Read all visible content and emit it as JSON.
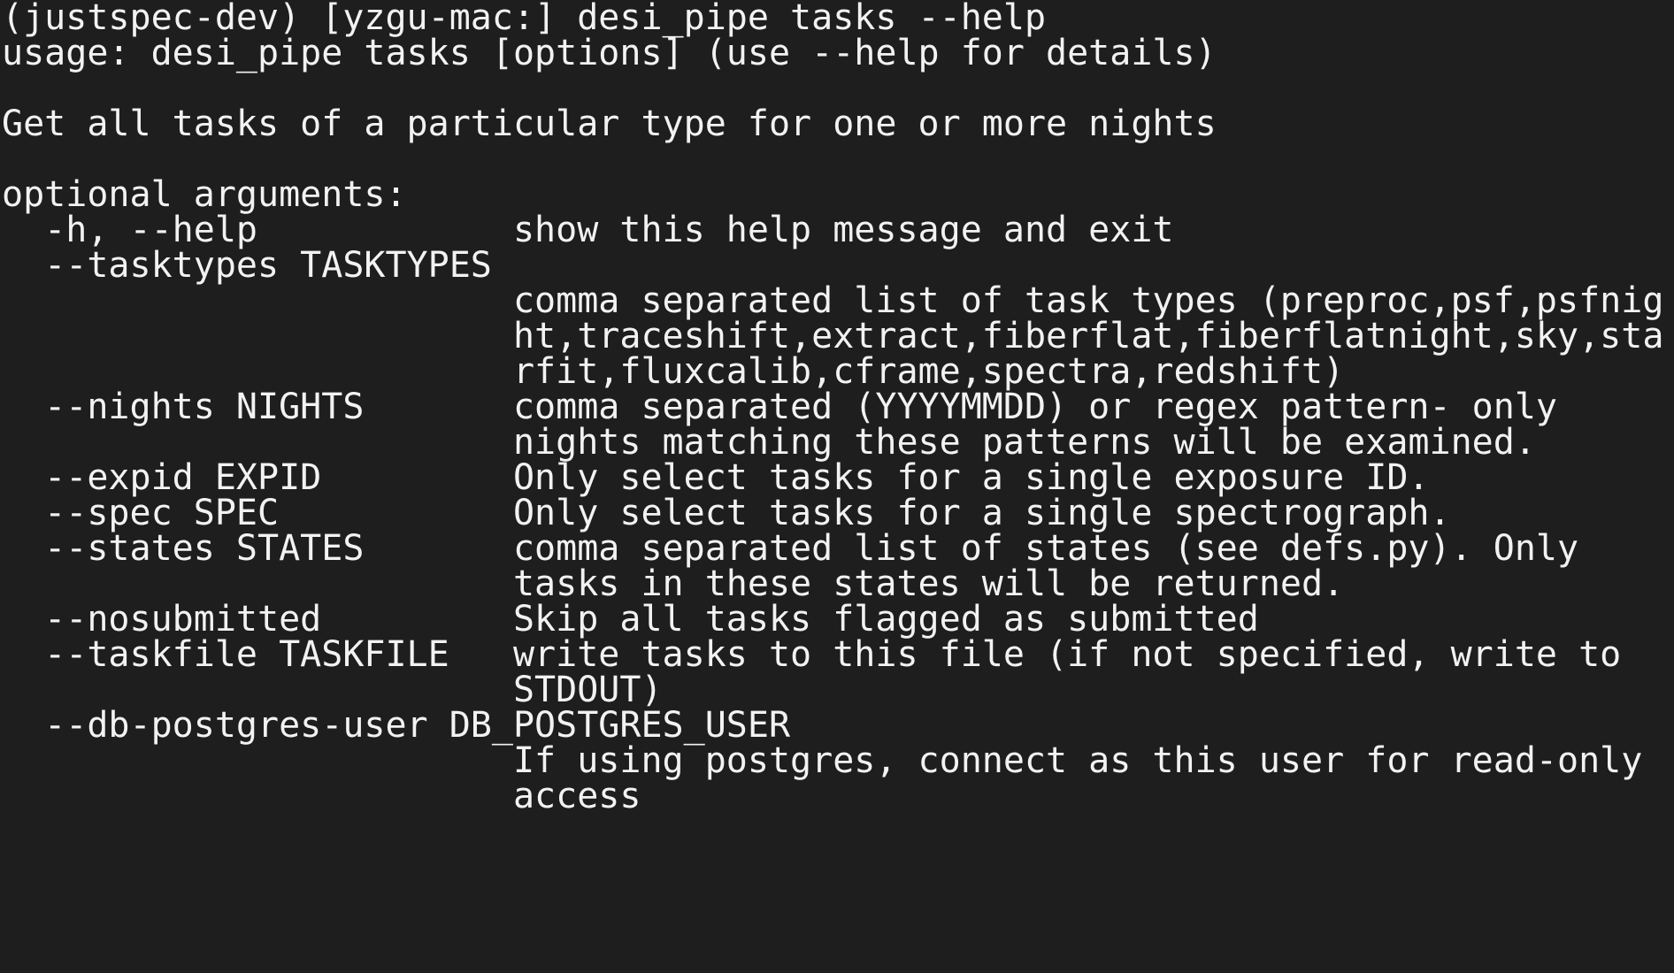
{
  "terminal": {
    "lines": [
      "(justspec-dev) [yzgu-mac:] desi_pipe tasks --help",
      "usage: desi_pipe tasks [options] (use --help for details)",
      "",
      "Get all tasks of a particular type for one or more nights",
      "",
      "optional arguments:",
      "  -h, --help            show this help message and exit",
      "  --tasktypes TASKTYPES",
      "                        comma separated list of task types (preproc,psf,psfnig",
      "                        ht,traceshift,extract,fiberflat,fiberflatnight,sky,sta",
      "                        rfit,fluxcalib,cframe,spectra,redshift)",
      "  --nights NIGHTS       comma separated (YYYYMMDD) or regex pattern- only",
      "                        nights matching these patterns will be examined.",
      "  --expid EXPID         Only select tasks for a single exposure ID.",
      "  --spec SPEC           Only select tasks for a single spectrograph.",
      "  --states STATES       comma separated list of states (see defs.py). Only",
      "                        tasks in these states will be returned.",
      "  --nosubmitted         Skip all tasks flagged as submitted",
      "  --taskfile TASKFILE   write tasks to this file (if not specified, write to",
      "                        STDOUT)",
      "  --db-postgres-user DB_POSTGRES_USER",
      "                        If using postgres, connect as this user for read-only",
      "                        access"
    ]
  }
}
